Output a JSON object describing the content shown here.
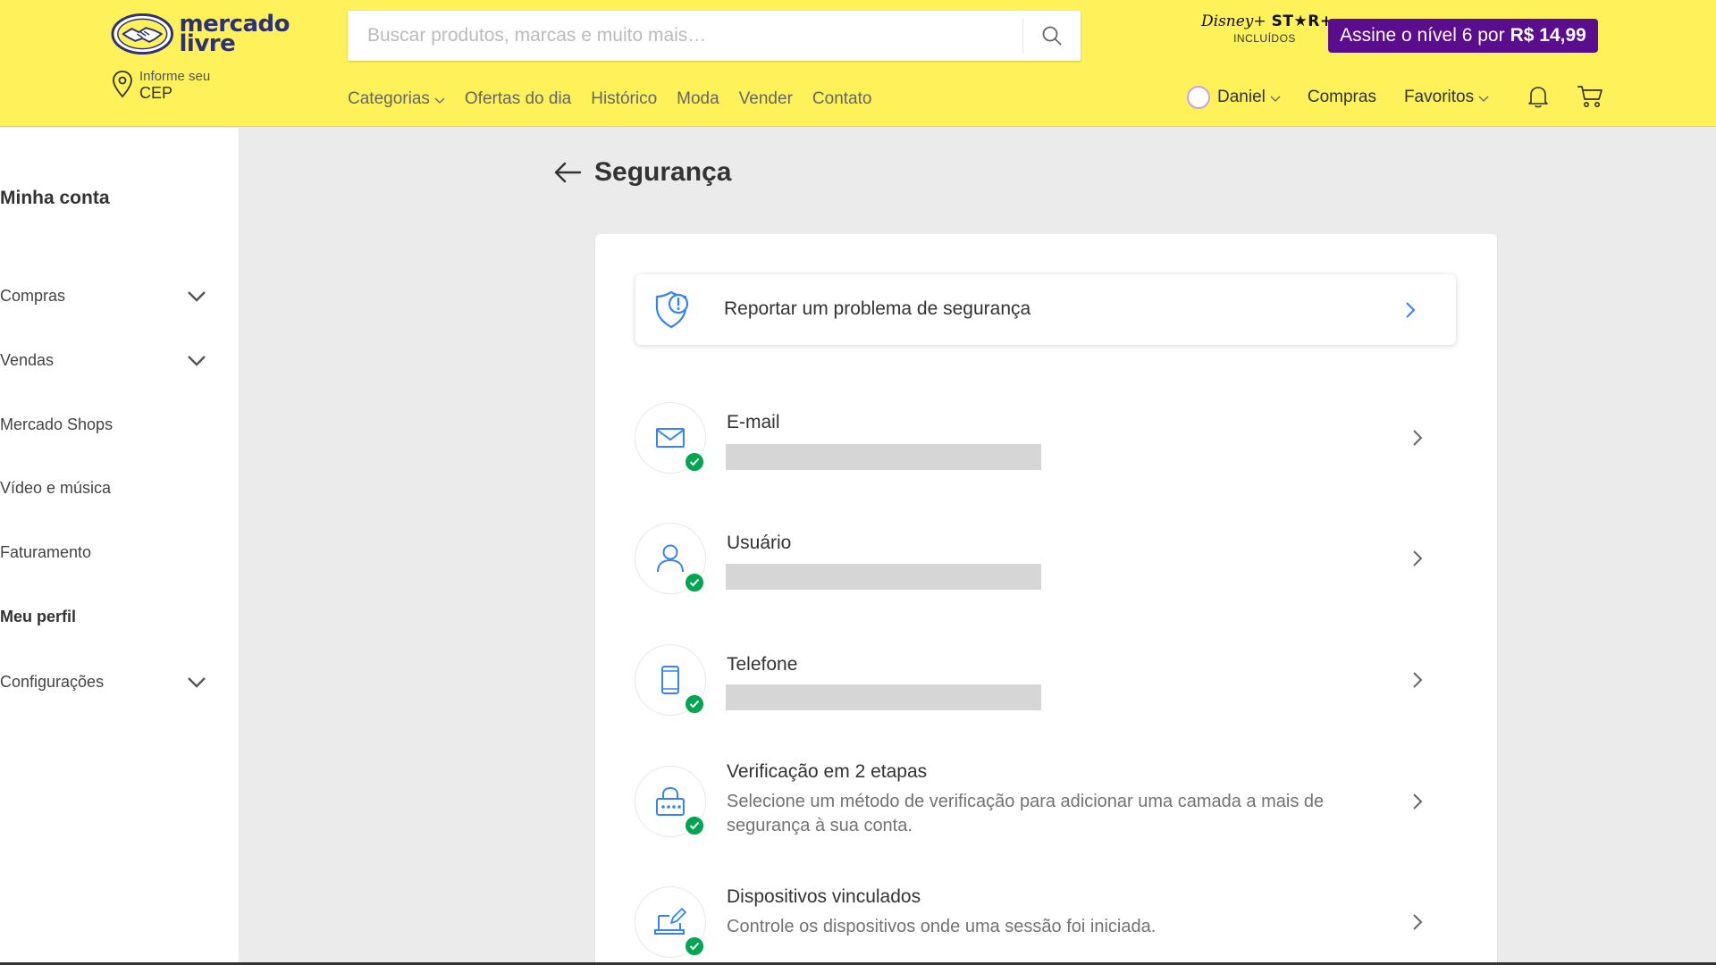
{
  "header": {
    "logo": {
      "line1": "mercado",
      "line2": "livre"
    },
    "cep": {
      "small": "Informe seu",
      "big": "CEP"
    },
    "search": {
      "placeholder": "Buscar produtos, marcas e muito mais…"
    },
    "disney": {
      "brand": "Disney+",
      "star": "ST★R+",
      "included": "INCLUÍDOS"
    },
    "promo": {
      "text": "Assine o nível 6 por",
      "price": "R$ 14,99"
    },
    "nav": [
      "Categorias",
      "Ofertas do dia",
      "Histórico",
      "Moda",
      "Vender",
      "Contato"
    ],
    "user": {
      "name": "Daniel",
      "purchases": "Compras",
      "favorites": "Favoritos"
    },
    "colors": {
      "bg": "#fff159",
      "promo": "#5a0d8c",
      "brand_blue": "#2d3277"
    }
  },
  "sidebar": {
    "title": "Minha conta",
    "items": [
      {
        "label": "Compras",
        "expandable": true
      },
      {
        "label": "Vendas",
        "expandable": true
      },
      {
        "label": "Mercado Shops",
        "expandable": false
      },
      {
        "label": "Vídeo e música",
        "expandable": false
      },
      {
        "label": "Faturamento",
        "expandable": false
      },
      {
        "label": "Meu perfil",
        "expandable": false,
        "active": true
      },
      {
        "label": "Configurações",
        "expandable": true
      }
    ]
  },
  "main": {
    "title": "Segurança",
    "report": {
      "label": "Reportar um problema de segurança"
    },
    "rows": [
      {
        "title": "E-mail",
        "value_masked": true,
        "icon": "mail-icon"
      },
      {
        "title": "Usuário",
        "value_masked": true,
        "icon": "user-icon"
      },
      {
        "title": "Telefone",
        "value_masked": true,
        "icon": "phone-icon"
      },
      {
        "title": "Verificação em 2 etapas",
        "desc": "Selecione um método de verificação para adicionar uma camada a mais de segurança à sua conta.",
        "icon": "lock-icon"
      },
      {
        "title": "Dispositivos vinculados",
        "desc": "Controle os dispositivos onde uma sessão foi iniciada.",
        "icon": "devices-icon"
      }
    ],
    "colors": {
      "icon": "#3483fa",
      "check": "#00a650"
    }
  }
}
